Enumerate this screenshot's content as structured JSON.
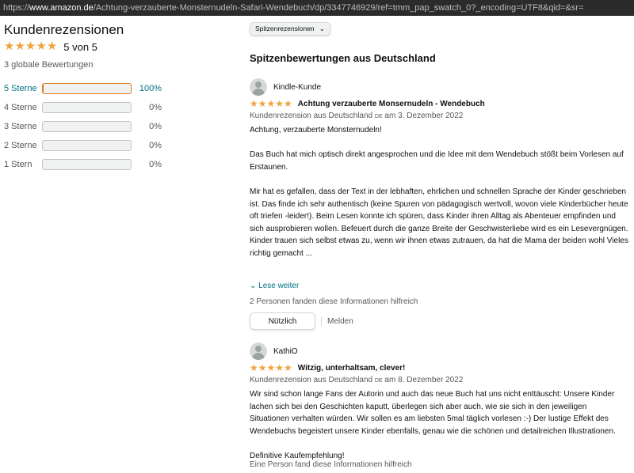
{
  "browser": {
    "url_prefix": "https://",
    "url_host": "www.amazon.de",
    "url_path": "/Achtung-verzauberte-Monsternudeln-Safari-Wendebuch/dp/3347746929/ref=tmm_pap_swatch_0?_encoding=UTF8&qid=&sr="
  },
  "summary": {
    "heading": "Kundenrezensionen",
    "rating_stars": "★★★★★",
    "rating_text": "5 von 5",
    "total_ratings": "3 globale Bewertungen",
    "histogram": [
      {
        "label": "5 Sterne",
        "percent_text": "100%",
        "fraction": 1.0
      },
      {
        "label": "4 Sterne",
        "percent_text": "0%",
        "fraction": 0.0
      },
      {
        "label": "3 Sterne",
        "percent_text": "0%",
        "fraction": 0.0
      },
      {
        "label": "2 Sterne",
        "percent_text": "0%",
        "fraction": 0.0
      },
      {
        "label": "1 Stern",
        "percent_text": "0%",
        "fraction": 0.0
      }
    ]
  },
  "sort": {
    "selected": "Spitzenrezensionen"
  },
  "section_title": "Spitzenbewertungen aus Deutschland",
  "reviews": [
    {
      "author": "Kindle-Kunde",
      "stars": "★★★★★",
      "title": "Achtung verzauberte Monsernudeln - Wendebuch",
      "meta_before": "Kundenrezension aus Deutschland",
      "meta_flag": "DE",
      "meta_after": "am 3. Dezember 2022",
      "paragraphs": [
        "Achtung, verzauberte Monsternudeln!",
        "Das Buch hat mich optisch direkt angesprochen und die Idee mit dem Wendebuch stößt beim Vorlesen auf Erstaunen.",
        "Mir hat es gefallen, dass der Text in der lebhaften, ehrlichen und schnellen Sprache der Kinder geschrieben ist. Das finde ich sehr authentisch (keine Spuren von pädagogisch wertvoll, wovon viele Kinderbücher heute oft triefen -leider!). Beim Lesen konnte ich spüren, dass Kinder ihren Alltag als Abenteuer empfinden und sich ausprobieren wollen. Befeuert durch die ganze Breite der Geschwisterliebe wird es ein Lesevergnügen. Kinder trauen sich selbst etwas zu, wenn wir ihnen etwas zutrauen, da hat die Mama der beiden wohl Vieles richtig gemacht ..."
      ],
      "read_more": "Lese weiter",
      "read_more_icon": "chevron-down-icon",
      "helpful": "2 Personen fanden diese Informationen hilfreich",
      "helpful_button": "Nützlich",
      "report": "Melden"
    },
    {
      "author": "KathiO",
      "stars": "★★★★★",
      "title": "Witzig, unterhaltsam, clever!",
      "meta_before": "Kundenrezension aus Deutschland",
      "meta_flag": "DE",
      "meta_after": "am 8. Dezember 2022",
      "paragraphs": [
        "Wir sind schon lange Fans der Autorin und auch das neue Buch hat uns nicht enttäuscht: Unsere Kinder lachen sich bei den Geschichten kaputt, überlegen sich aber auch, wie sie sich in den jeweiligen Situationen verhalten würden. Wir sollen es am liebsten 5mal täglich vorlesen :-) Der lustige Effekt des Wendebuchs begeistert unsere Kinder ebenfalls, genau wie die schönen und detailreichen Illustrationen.",
        "Definitive Kaufempfehlung!"
      ],
      "helpful": "Eine Person fand diese Informationen hilfreich"
    }
  ]
}
